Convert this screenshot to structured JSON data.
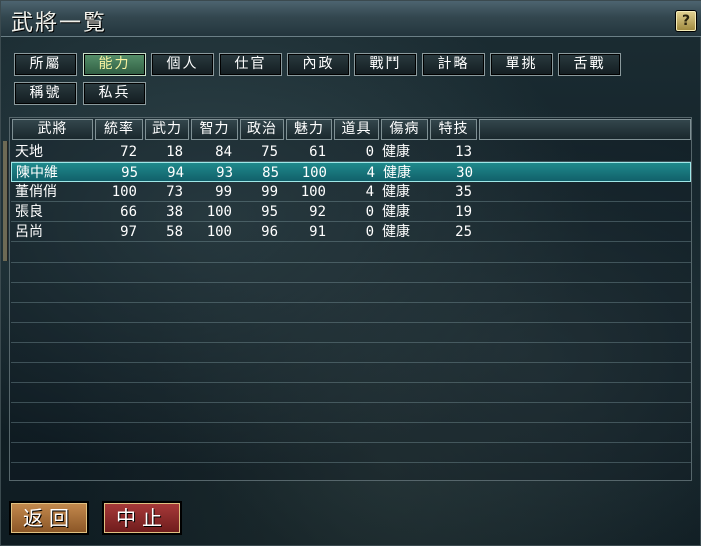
{
  "window": {
    "title": "武將一覧",
    "help_label": "?"
  },
  "tabs": [
    {
      "label": "所屬"
    },
    {
      "label": "能力"
    },
    {
      "label": "個人"
    },
    {
      "label": "仕官"
    },
    {
      "label": "內政"
    },
    {
      "label": "戰鬥"
    },
    {
      "label": "計略"
    },
    {
      "label": "單挑"
    },
    {
      "label": "舌戰"
    },
    {
      "label": "稱號"
    },
    {
      "label": "私兵"
    }
  ],
  "active_tab": "能力",
  "table": {
    "headers": [
      "武將",
      "統率",
      "武力",
      "智力",
      "政治",
      "魅力",
      "道具",
      "傷病",
      "特技"
    ],
    "rows": [
      {
        "name": "天地",
        "tong": "72",
        "wu": "18",
        "zhi": "84",
        "zheng": "75",
        "mei": "61",
        "item": "0",
        "status": "健康",
        "skill": "13"
      },
      {
        "name": "陳中維",
        "tong": "95",
        "wu": "94",
        "zhi": "93",
        "zheng": "85",
        "mei": "100",
        "item": "4",
        "status": "健康",
        "skill": "30"
      },
      {
        "name": "董俏俏",
        "tong": "100",
        "wu": "73",
        "zhi": "99",
        "zheng": "99",
        "mei": "100",
        "item": "4",
        "status": "健康",
        "skill": "35"
      },
      {
        "name": "張良",
        "tong": "66",
        "wu": "38",
        "zhi": "100",
        "zheng": "95",
        "mei": "92",
        "item": "0",
        "status": "健康",
        "skill": "19"
      },
      {
        "name": "呂尚",
        "tong": "97",
        "wu": "58",
        "zhi": "100",
        "zheng": "96",
        "mei": "91",
        "item": "0",
        "status": "健康",
        "skill": "25"
      }
    ],
    "selected_row": "陳中維"
  },
  "buttons": {
    "back": "返回",
    "stop": "中止"
  }
}
